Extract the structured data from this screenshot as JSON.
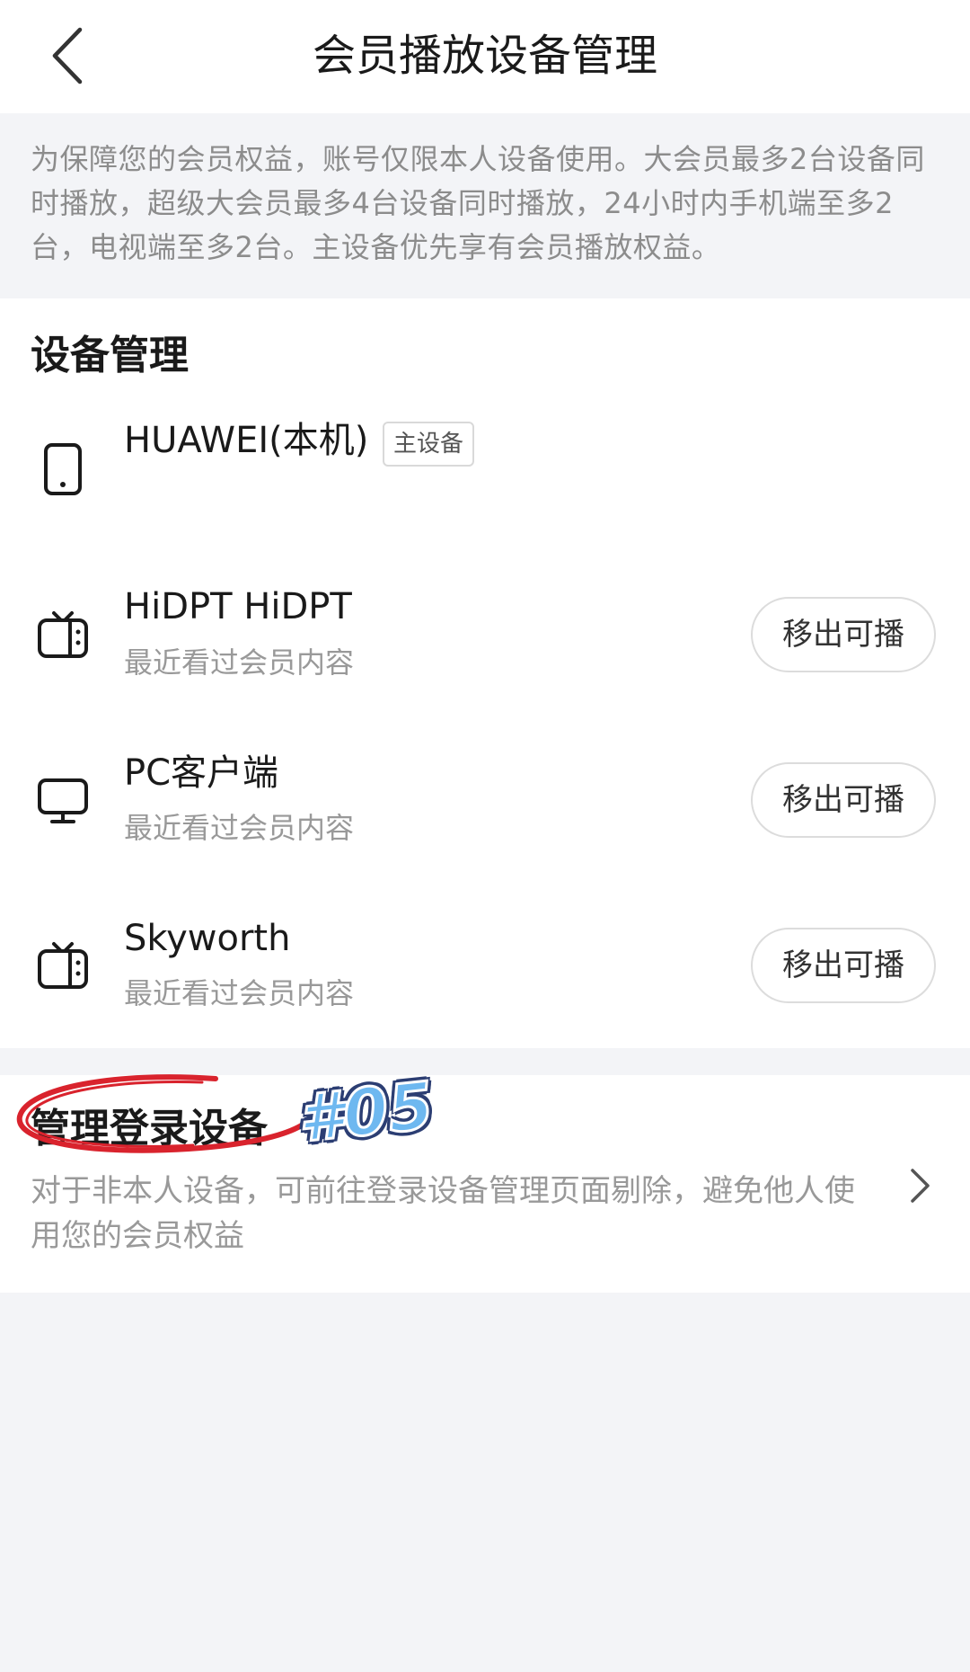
{
  "header": {
    "title": "会员播放设备管理"
  },
  "notice": {
    "text": "为保障您的会员权益，账号仅限本人设备使用。大会员最多2台设备同时播放，超级大会员最多4台设备同时播放，24小时内手机端至多2台，电视端至多2台。主设备优先享有会员播放权益。"
  },
  "devices_section": {
    "title": "设备管理",
    "primary_badge": "主设备",
    "devices": [
      {
        "name": "HUAWEI(本机)",
        "icon": "phone-icon",
        "subtitle": ""
      },
      {
        "name": "HiDPT HiDPT",
        "icon": "tv-icon",
        "subtitle": "最近看过会员内容",
        "action": "移出可播"
      },
      {
        "name": "PC客户端",
        "icon": "monitor-icon",
        "subtitle": "最近看过会员内容",
        "action": "移出可播"
      },
      {
        "name": "Skyworth",
        "icon": "tv-icon",
        "subtitle": "最近看过会员内容",
        "action": "移出可播"
      }
    ]
  },
  "login_section": {
    "title": "管理登录设备",
    "description": "对于非本人设备，可前往登录设备管理页面剔除，避免他人使用您的会员权益"
  },
  "annotation": {
    "tag": "#05",
    "highlight_color": "#d9232d",
    "tag_color": "#6eb8f0"
  }
}
